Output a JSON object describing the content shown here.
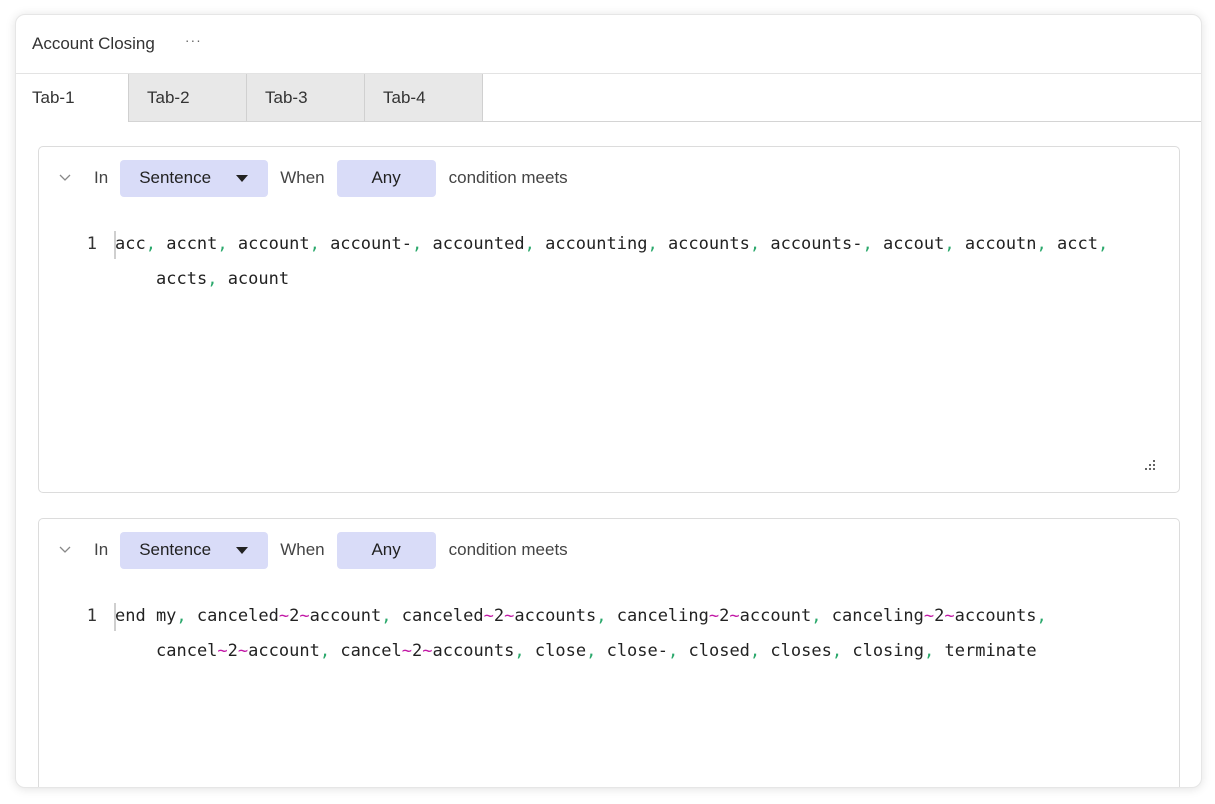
{
  "header": {
    "title": "Account Closing",
    "more_label": "···"
  },
  "tabs": [
    {
      "label": "Tab-1",
      "active": true
    },
    {
      "label": "Tab-2"
    },
    {
      "label": "Tab-3"
    },
    {
      "label": "Tab-4"
    }
  ],
  "rules": [
    {
      "in_label": "In",
      "scope_value": "Sentence",
      "when_label": "When",
      "match_value": "Any",
      "condition_label": "condition meets",
      "line_number": "1",
      "line1": [
        "acc",
        "accnt",
        "account",
        "account-",
        "accounted",
        "accounting",
        "accounts",
        "accounts-",
        "accout",
        "accoutn",
        "acct"
      ],
      "line2": [
        "accts",
        "acount"
      ]
    },
    {
      "in_label": "In",
      "scope_value": "Sentence",
      "when_label": "When",
      "match_value": "Any",
      "condition_label": "condition meets",
      "line_number": "1",
      "line1": [
        "end my",
        "canceled~2~account",
        "canceled~2~accounts",
        "canceling~2~account",
        "canceling~2~accounts"
      ],
      "line2": [
        "cancel~2~account",
        "cancel~2~accounts",
        "close",
        "close-",
        "closed",
        "closes",
        "closing",
        "terminate"
      ]
    }
  ],
  "colors": {
    "accent_button": "#d9dcf8",
    "comma": "#2aa86b",
    "proximity_operator": "#c218a6"
  },
  "icons": {
    "collapse": "chevron-down-icon",
    "resize": "resize-handle-icon",
    "dropdown": "caret-down-icon"
  }
}
